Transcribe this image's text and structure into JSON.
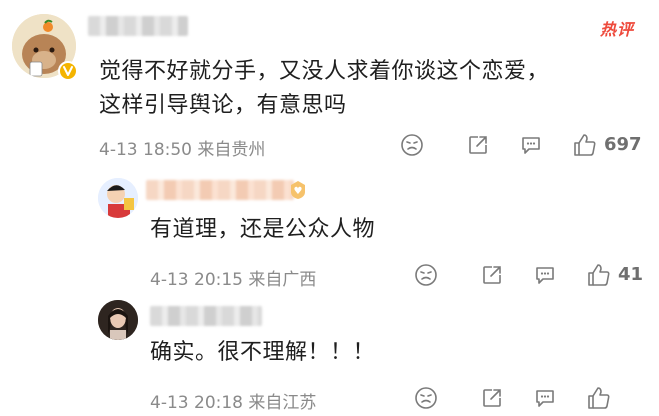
{
  "badge": {
    "hot": "热评"
  },
  "comments": [
    {
      "text_line1": "觉得不好就分手，又没人求着你谈这个恋爱，",
      "text_line2": "这样引导舆论，有意思吗",
      "date": "4-13",
      "time": "18:50",
      "location": "来自贵州",
      "likes": "697",
      "verified": true
    },
    {
      "text_line1": "有道理，还是公众人物",
      "date": "4-13",
      "time": "20:15",
      "location": "来自广西",
      "likes": "41"
    },
    {
      "text_line1": "确实。很不理解！！！",
      "date": "4-13",
      "time": "20:18",
      "location": "来自江苏",
      "likes": ""
    }
  ],
  "colors": {
    "hot": "#ee4a3c",
    "verified": "#f4b400",
    "meta": "#8a8a8a"
  }
}
